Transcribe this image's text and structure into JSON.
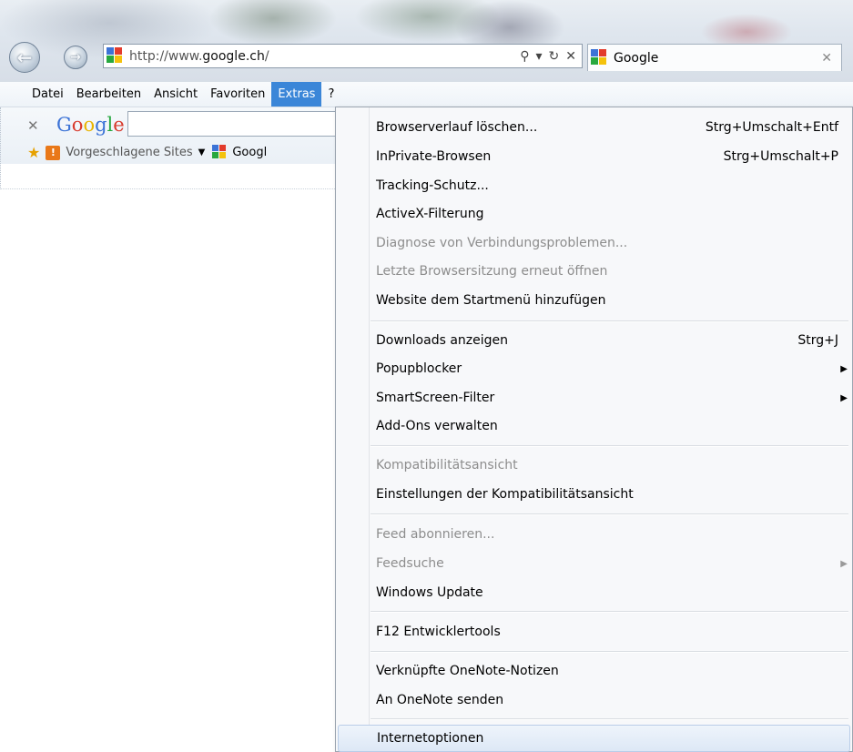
{
  "browser": {
    "url_prefix": "http://www.",
    "url_host": "google.ch",
    "url_suffix": "/",
    "tab_title": "Google"
  },
  "menubar": {
    "items": [
      "Datei",
      "Bearbeiten",
      "Ansicht",
      "Favoriten",
      "Extras",
      "?"
    ],
    "active": "Extras"
  },
  "toolbar": {
    "google_logo": "Google",
    "suggested_sites": "Vorgeschlagene Sites",
    "google_fav_label": "Googl"
  },
  "extras_menu": {
    "items": [
      {
        "label": "Browserverlauf löschen...",
        "shortcut": "Strg+Umschalt+Entf"
      },
      {
        "label": "InPrivate-Browsen",
        "shortcut": "Strg+Umschalt+P"
      },
      {
        "label": "Tracking-Schutz..."
      },
      {
        "label": "ActiveX-Filterung"
      },
      {
        "label": "Diagnose von Verbindungsproblemen...",
        "disabled": true
      },
      {
        "label": "Letzte Browsersitzung erneut öffnen",
        "disabled": true
      },
      {
        "label": "Website dem Startmenü hinzufügen"
      },
      {
        "label": "Downloads anzeigen",
        "shortcut": "Strg+J"
      },
      {
        "label": "Popupblocker",
        "submenu": true
      },
      {
        "label": "SmartScreen-Filter",
        "submenu": true
      },
      {
        "label": "Add-Ons verwalten"
      },
      {
        "label": "Kompatibilitätsansicht",
        "disabled": true
      },
      {
        "label": "Einstellungen der Kompatibilitätsansicht"
      },
      {
        "label": "Feed abonnieren...",
        "disabled": true
      },
      {
        "label": "Feedsuche",
        "disabled": true,
        "submenu": true
      },
      {
        "label": "Windows Update"
      },
      {
        "label": "F12 Entwicklertools"
      },
      {
        "label": "Verknüpfte OneNote-Notizen"
      },
      {
        "label": "An OneNote senden"
      },
      {
        "label": "Internetoptionen",
        "highlighted": true
      }
    ]
  }
}
